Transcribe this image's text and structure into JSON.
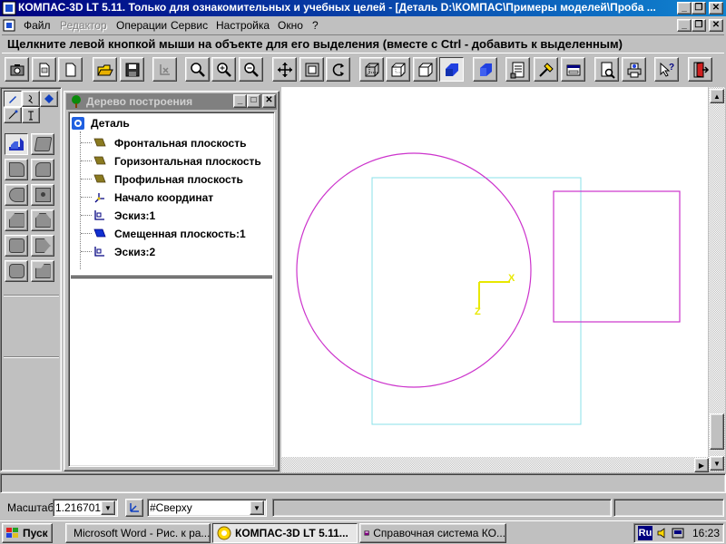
{
  "window": {
    "title": "КОМПАС-3D LT 5.11. Только для ознакомительных и учебных целей - [Деталь D:\\КОМПАС\\Примеры моделей\\Проба ..."
  },
  "menu": {
    "items": [
      {
        "label": "Файл",
        "enabled": true
      },
      {
        "label": "Редактор",
        "enabled": false
      },
      {
        "label": "Операции",
        "enabled": true
      },
      {
        "label": "Сервис",
        "enabled": true
      },
      {
        "label": "Настройка",
        "enabled": true
      },
      {
        "label": "Окно",
        "enabled": true
      },
      {
        "label": "?",
        "enabled": true
      }
    ]
  },
  "hint": {
    "text": "Щелкните левой кнопкой мыши на объекте для его выделения (вместе с Ctrl - добавить к выделенным)"
  },
  "toolbar": {
    "buttons": [
      "camera-icon",
      "new-document-icon",
      "new-sheet-icon",
      "open-folder-icon",
      "save-icon",
      "cut-icon",
      "zoom-icon",
      "zoom-in-icon",
      "zoom-out-icon",
      "pan-icon",
      "zoom-fit-icon",
      "rotate-icon",
      "wireframe-icon",
      "hidden-lines-icon",
      "no-hidden-lines-icon",
      "shaded-icon",
      "perspective-icon",
      "properties-icon",
      "measure-icon",
      "settings-icon",
      "preview-icon",
      "print-icon",
      "help-pointer-icon",
      "exit-icon"
    ],
    "active": "shaded-icon"
  },
  "tree": {
    "title": "Дерево построения",
    "root": "Деталь",
    "items": [
      {
        "label": "Фронтальная плоскость",
        "icon": "plane-icon"
      },
      {
        "label": "Горизонтальная плоскость",
        "icon": "plane-icon"
      },
      {
        "label": "Профильная плоскость",
        "icon": "plane-icon"
      },
      {
        "label": "Начало координат",
        "icon": "origin-icon"
      },
      {
        "label": "Эскиз:1",
        "icon": "sketch-icon"
      },
      {
        "label": "Смещенная плоскость:1",
        "icon": "offset-plane-icon"
      },
      {
        "label": "Эскиз:2",
        "icon": "sketch-icon"
      }
    ]
  },
  "canvas": {
    "axis_labels": {
      "x": "X",
      "z": "Z"
    },
    "colors": {
      "sketch": "#cc33cc",
      "plane": "#88e0e8",
      "axis": "#e8e800"
    }
  },
  "status": {
    "scale_label": "Масштаб",
    "scale_value": "1.216701",
    "view_value": "#Сверху"
  },
  "taskbar": {
    "start_label": "Пуск",
    "tasks": [
      {
        "label": "Microsoft Word - Рис. к ра...",
        "icon": "word-icon",
        "active": false
      },
      {
        "label": "КОМПАС-3D LT 5.11...",
        "icon": "kompas-icon",
        "active": true
      },
      {
        "label": "Справочная система КО...",
        "icon": "help-book-icon",
        "active": false
      }
    ],
    "language": "Ru",
    "clock": "16:23"
  }
}
